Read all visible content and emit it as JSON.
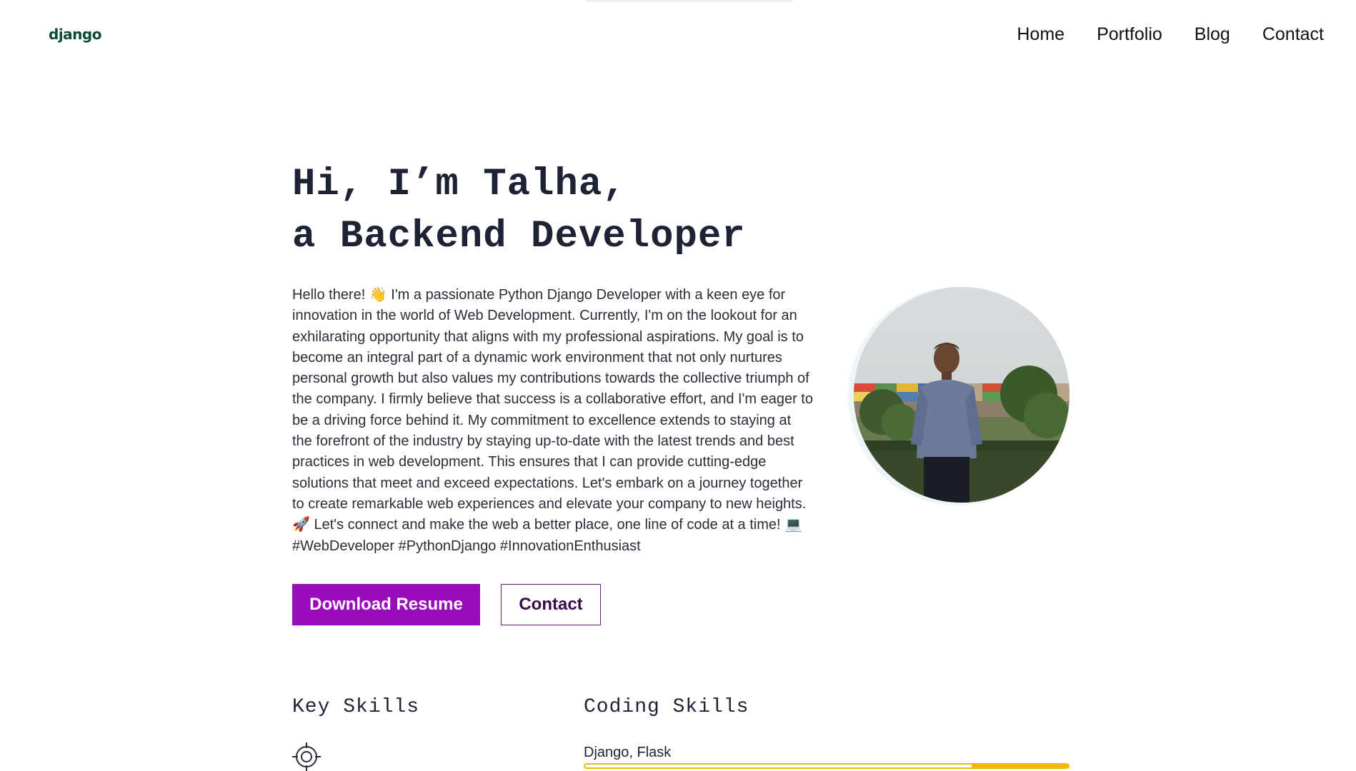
{
  "brand": {
    "logo_text": "django",
    "accent_color": "#9a0cbb",
    "logo_color": "#0c4b33"
  },
  "nav": {
    "items": [
      {
        "label": "Home"
      },
      {
        "label": "Portfolio"
      },
      {
        "label": "Blog"
      },
      {
        "label": "Contact"
      }
    ]
  },
  "hero": {
    "title_line1": "Hi, I’m Talha,",
    "title_line2": "a Backend Developer",
    "bio": "Hello there! 👋 I'm a passionate Python Django Developer with a keen eye for innovation in the world of Web Development. Currently, I'm on the lookout for an exhilarating opportunity that aligns with my professional aspirations. My goal is to become an integral part of a dynamic work environment that not only nurtures personal growth but also values my contributions towards the collective triumph of the company. I firmly believe that success is a collaborative effort, and I'm eager to be a driving force behind it. My commitment to excellence extends to staying at the forefront of the industry by staying up-to-date with the latest trends and best practices in web development. This ensures that I can provide cutting-edge solutions that meet and exceed expectations. Let's embark on a journey together to create remarkable web experiences and elevate your company to new heights. 🚀 Let's connect and make the web a better place, one line of code at a time! 💻 #WebDeveloper #PythonDjango #InnovationEnthusiast",
    "primary_button": "Download Resume",
    "secondary_button": "Contact"
  },
  "key_skills": {
    "title": "Key Skills",
    "first_icon": "target-icon"
  },
  "coding_skills": {
    "title": "Coding Skills",
    "items": [
      {
        "label": "Django, Flask",
        "level": 0.2,
        "color": "#f2b900"
      }
    ]
  }
}
